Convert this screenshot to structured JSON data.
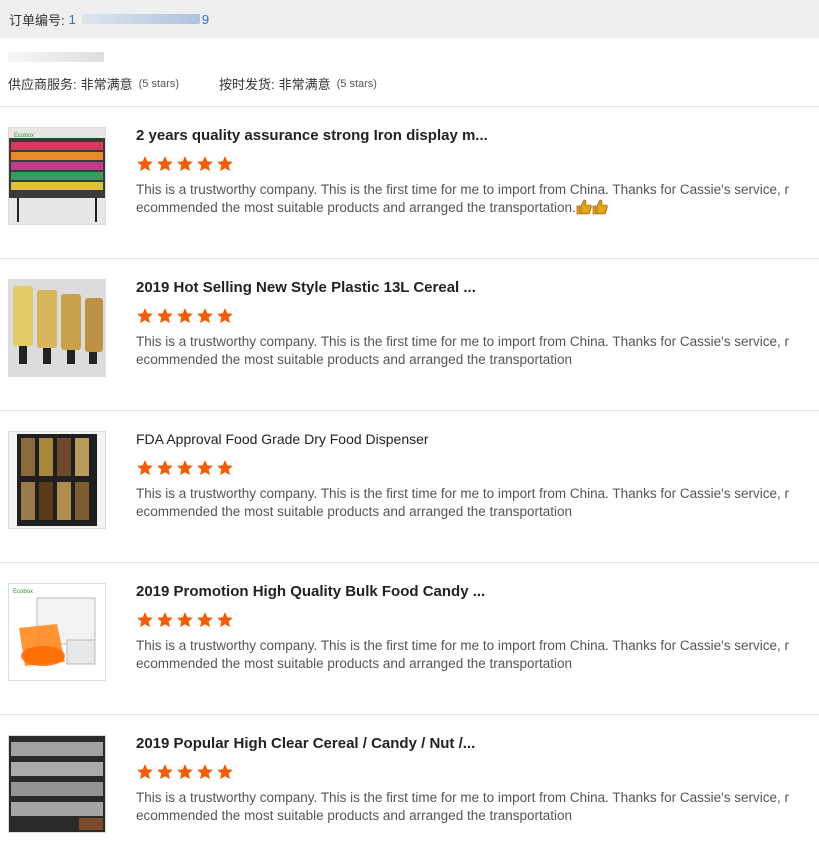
{
  "header": {
    "order_label": "订单编号:",
    "order_number_prefix": "1",
    "order_number_suffix": "9"
  },
  "summary": {
    "supplier_service_label": "供应商服务:",
    "supplier_service_value": "非常满意",
    "supplier_service_stars": "(5 stars)",
    "delivery_label": "按时发货:",
    "delivery_value": "非常满意",
    "delivery_stars": "(5 stars)"
  },
  "items": [
    {
      "title": "2 years quality assurance strong Iron display m...",
      "rating": 5,
      "review": "This is a trustworthy company. This is the first time for me to import from China. Thanks for Cassie's service, recommended the most suitable products and arranged the transportation.",
      "thumb_icons": [
        "thumbs-up-icon",
        "thumbs-up-icon"
      ]
    },
    {
      "title": "2019 Hot Selling New Style Plastic 13L Cereal ...",
      "rating": 5,
      "review": "This is a trustworthy company. This is the first time for me to import from China. Thanks for Cassie's service, recommended the most suitable products and arranged the transportation"
    },
    {
      "title": "FDA Approval Food Grade Dry Food Dispenser",
      "rating": 5,
      "review": "This is a trustworthy company. This is the first time for me to import from China. Thanks for Cassie's service, recommended the most suitable products and arranged the transportation"
    },
    {
      "title": "2019 Promotion High Quality Bulk Food Candy ...",
      "rating": 5,
      "review": "This is a trustworthy company. This is the first time for me to import from China. Thanks for Cassie's service, recommended the most suitable products and arranged the transportation"
    },
    {
      "title": "2019 Popular High Clear Cereal / Candy / Nut /...",
      "rating": 5,
      "review": "This is a trustworthy company. This is the first time for me to import from China. Thanks for Cassie's service, recommended the most suitable products and arranged the transportation"
    }
  ],
  "colors": {
    "star": "#f25c05",
    "link": "#2a6fd1",
    "topbar_bg": "#efefef"
  }
}
